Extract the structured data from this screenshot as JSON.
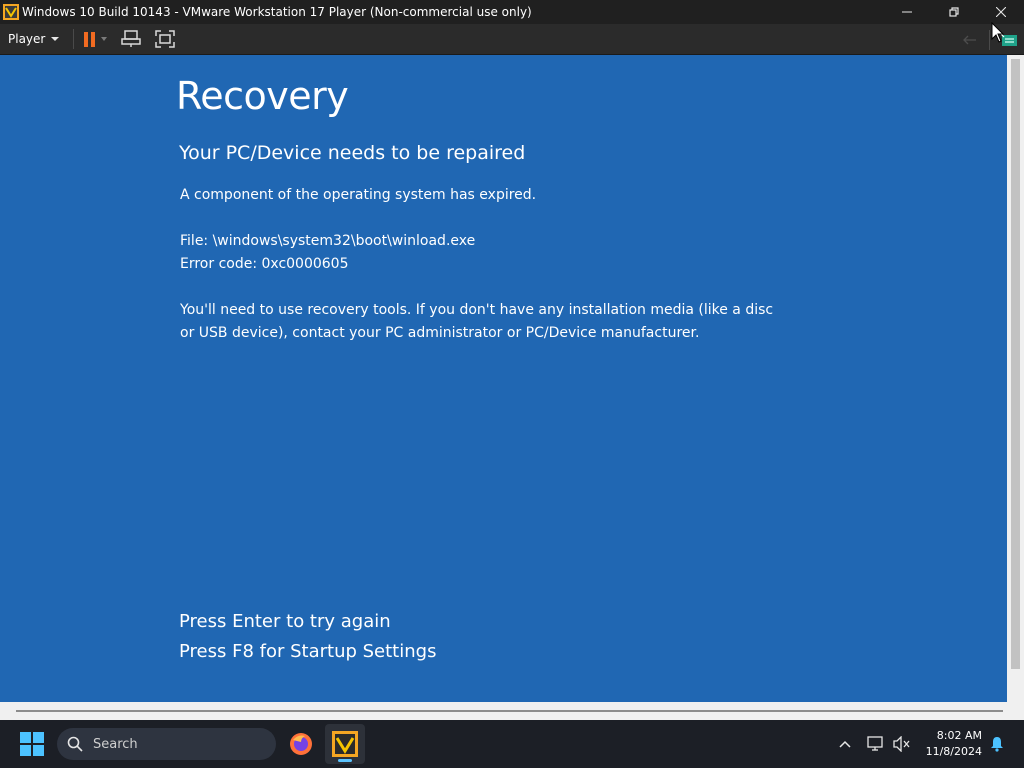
{
  "window": {
    "title": "Windows 10 Build 10143 - VMware Workstation 17 Player (Non-commercial use only)",
    "controls": [
      "minimize-icon",
      "restore-icon",
      "close-icon"
    ]
  },
  "toolbar": {
    "player_label": "Player",
    "buttons": [
      "pause-icon",
      "send-ctrl-alt-del-icon",
      "fullscreen-icon"
    ],
    "right_icons": [
      "back-arrow-icon",
      "unity-message-icon"
    ],
    "accent_color": "#f26b21"
  },
  "vm": {
    "background_color": "#2067b3",
    "title": "Recovery",
    "subtitle": "Your PC/Device needs to be repaired",
    "message": "A component of the operating system has expired.",
    "file_line": "File: \\windows\\system32\\boot\\winload.exe",
    "error_line": "Error code: 0xc0000605",
    "instructions": "You'll need to use recovery tools. If you don't have any installation media (like a disc or USB device), contact your PC administrator or PC/Device manufacturer.",
    "action_enter": "Press Enter to try again",
    "action_f8": "Press F8 for Startup Settings"
  },
  "taskbar": {
    "search_placeholder": "Search",
    "apps": [
      "firefox-icon",
      "vmware-player-icon"
    ],
    "tray_icons": [
      "chevron-up-icon",
      "network-icon",
      "volume-muted-icon",
      "notification-bell-icon"
    ],
    "time": "8:02 AM",
    "date": "11/8/2024"
  }
}
